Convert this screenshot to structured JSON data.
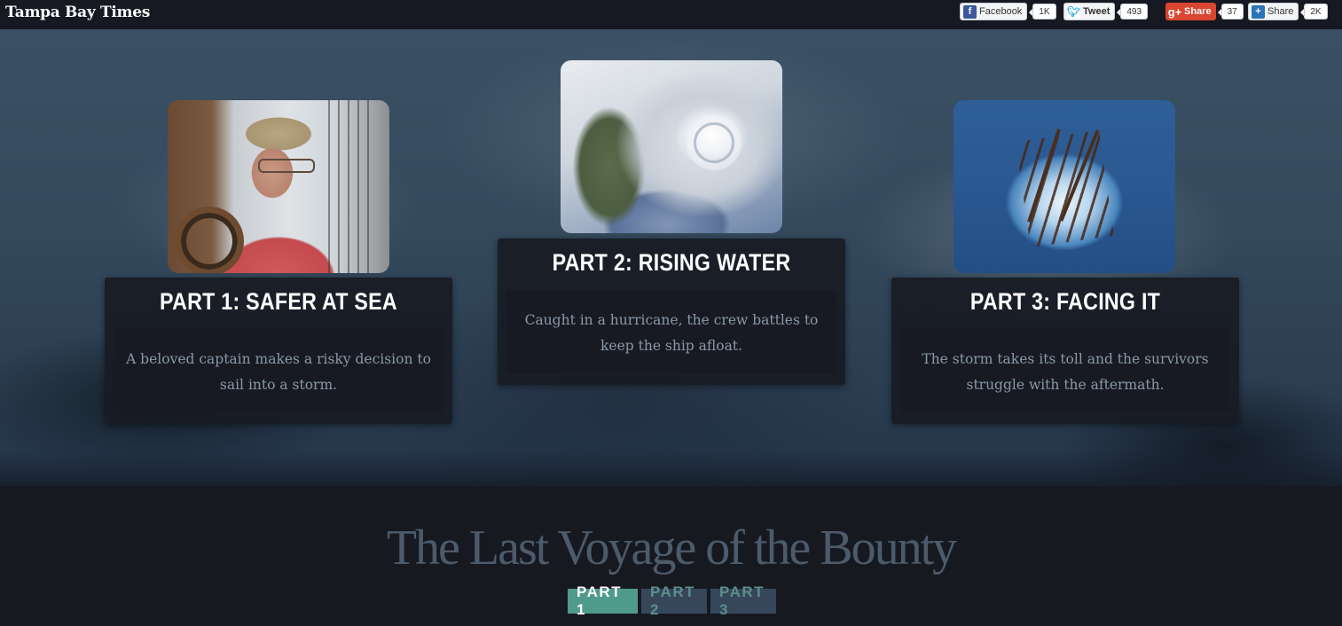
{
  "header": {
    "logo": "Tampa Bay Times",
    "social": {
      "facebook": {
        "label": "Facebook",
        "count": "1K"
      },
      "twitter": {
        "label": "Tweet",
        "count": "493"
      },
      "gplus": {
        "label": "Share",
        "count": "37"
      },
      "share": {
        "label": "Share",
        "count": "2K"
      }
    }
  },
  "parts": [
    {
      "title": "PART 1: SAFER AT SEA",
      "text": "A beloved captain makes a risky decision to sail into a storm.",
      "image": "captain-photo"
    },
    {
      "title": "PART 2: RISING WATER",
      "text": "Caught in a hurricane, the crew battles to keep the ship afloat.",
      "image": "hurricane-satellite-photo"
    },
    {
      "title": "PART 3: FACING IT",
      "text": "The storm takes its toll and the survivors struggle with the aftermath.",
      "image": "sinking-ship-photo"
    }
  ],
  "footer": {
    "title": "The Last Voyage of the Bounty",
    "nav": [
      "PART 1",
      "PART 2",
      "PART 3"
    ],
    "active_index": 0
  },
  "colors": {
    "background": "#171921",
    "active_tab": "#4f9a8b",
    "inactive_tab": "#36475a",
    "gplus_red": "#d9452f"
  }
}
